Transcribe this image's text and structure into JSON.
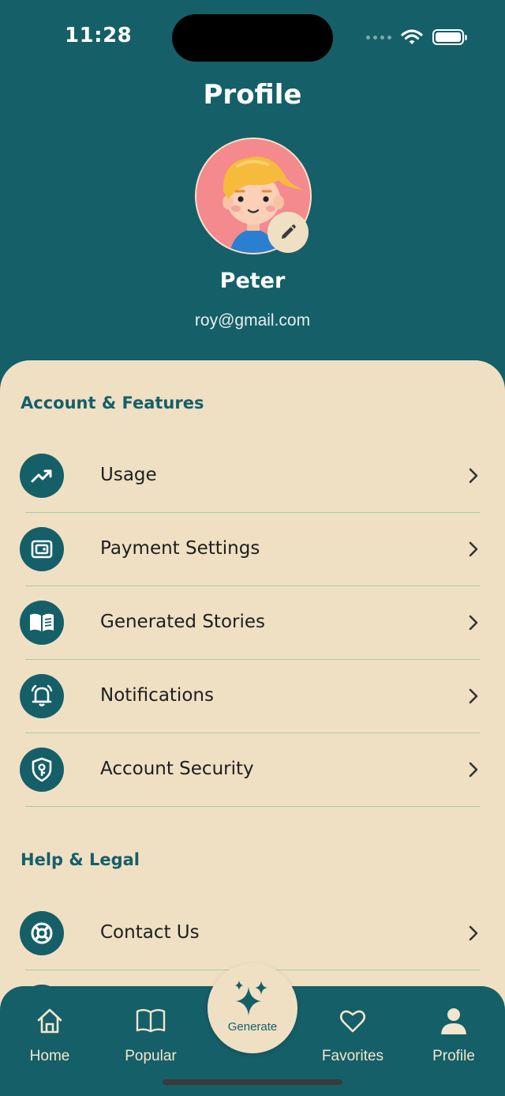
{
  "status_bar": {
    "time": "11:28"
  },
  "header": {
    "title": "Profile"
  },
  "user": {
    "name": "Peter",
    "email": "roy@gmail.com"
  },
  "sections": {
    "account": {
      "title": "Account & Features",
      "items": [
        {
          "label": "Usage",
          "icon": "trending-up-icon"
        },
        {
          "label": "Payment Settings",
          "icon": "wallet-icon"
        },
        {
          "label": "Generated Stories",
          "icon": "book-open-icon"
        },
        {
          "label": "Notifications",
          "icon": "bell-icon"
        },
        {
          "label": "Account Security",
          "icon": "shield-key-icon"
        }
      ]
    },
    "help": {
      "title": "Help & Legal",
      "items": [
        {
          "label": "Contact Us",
          "icon": "lifebuoy-icon"
        }
      ]
    }
  },
  "tabbar": {
    "home": "Home",
    "popular": "Popular",
    "generate": "Generate",
    "favorites": "Favorites",
    "profile": "Profile"
  },
  "colors": {
    "primary": "#155f68",
    "panel": "#efe0c4",
    "divider": "#a8c9a0",
    "avatar_bg": "#f48a8d"
  }
}
